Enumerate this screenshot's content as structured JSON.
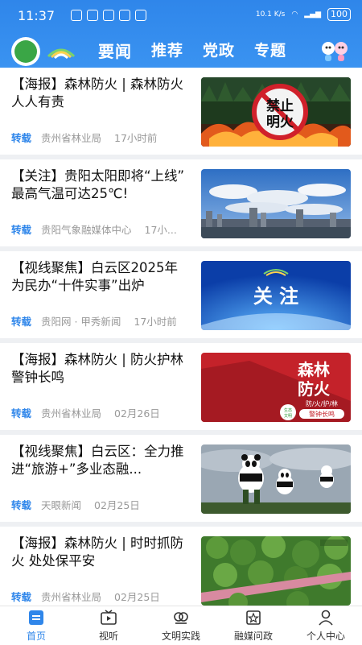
{
  "status_bar": {
    "time": "11:37",
    "net_speed": "10.1 K/s",
    "battery": "100"
  },
  "nav": {
    "tabs": [
      {
        "label": "要闻"
      },
      {
        "label": "推荐"
      },
      {
        "label": "党政"
      },
      {
        "label": "专题"
      }
    ]
  },
  "feed": [
    {
      "title": "【海报】森林防火 | 森林防火  人人有责",
      "share": "转载",
      "source": "贵州省林业局",
      "date": "17小时前",
      "image": "forest-fire-ban-poster"
    },
    {
      "title": "【关注】贵阳太阳即将“上线” 最高气温可达25℃!",
      "share": "转载",
      "source": "贵阳气象融媒体中心",
      "date": "17小...",
      "image": "city-skyline-blue-sky"
    },
    {
      "title": "【视线聚焦】白云区2025年为民办“十件实事”出炉",
      "share": "转载",
      "source": "贵阳网 · 甲秀新闻",
      "date": "17小时前",
      "image": "guanzhu-banner"
    },
    {
      "title": "【海报】森林防火 | 防火护林  警钟长鸣",
      "share": "转载",
      "source": "贵州省林业局",
      "date": "02月26日",
      "image": "forest-fire-prevention-poster"
    },
    {
      "title": "【视线聚焦】白云区：全力推进“旅游+”多业态融...",
      "share": "转载",
      "source": "天眼新闻",
      "date": "02月25日",
      "image": "panda-sculptures"
    },
    {
      "title": "【海报】森林防火 | 时时抓防火  处处保平安",
      "share": "转载",
      "source": "贵州省林业局",
      "date": "02月25日",
      "image": "forest-aerial-view"
    }
  ],
  "poster_text": {
    "jinzhi": "禁止明火",
    "guanzhu": "关注",
    "senlin": "森林",
    "fanghuo": "防火",
    "sub": "防/火/护/林",
    "jingzhong": "警钟长鸣",
    "shengtai": "生态文明"
  },
  "tabbar": [
    {
      "label": "首页",
      "icon": "home-icon",
      "active": true
    },
    {
      "label": "视听",
      "icon": "tv-icon"
    },
    {
      "label": "文明实践",
      "icon": "practice-icon"
    },
    {
      "label": "融媒问政",
      "icon": "star-badge-icon"
    },
    {
      "label": "个人中心",
      "icon": "user-icon"
    }
  ],
  "colors": {
    "accent": "#2f86ea",
    "header": "#3a93f1"
  }
}
